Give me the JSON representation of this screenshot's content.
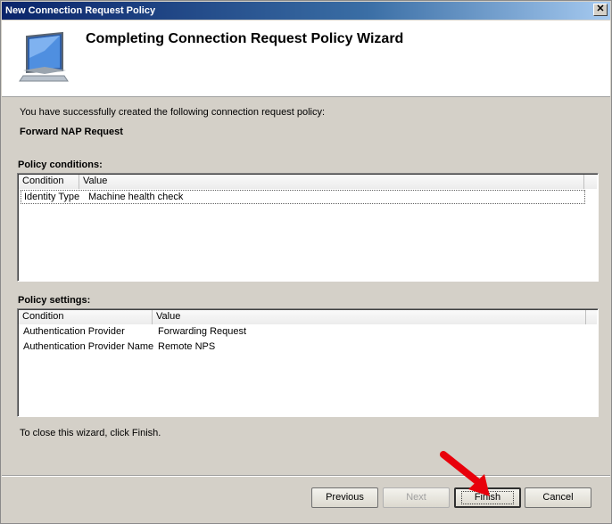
{
  "window": {
    "title": "New Connection Request Policy",
    "close_glyph": "✕"
  },
  "header": {
    "title": "Completing Connection Request Policy Wizard",
    "icon": "computer-monitor-icon"
  },
  "body": {
    "success_text": "You have successfully created the following connection request policy:",
    "policy_name": "Forward NAP Request",
    "close_hint": "To close this wizard, click Finish."
  },
  "conditions": {
    "label": "Policy conditions:",
    "columns": [
      "Condition",
      "Value"
    ],
    "rows": [
      {
        "condition": "Identity Type",
        "value": "Machine health check"
      }
    ]
  },
  "settings": {
    "label": "Policy settings:",
    "columns": [
      "Condition",
      "Value"
    ],
    "rows": [
      {
        "condition": "Authentication Provider",
        "value": "Forwarding Request"
      },
      {
        "condition": "Authentication Provider Name",
        "value": "Remote NPS"
      }
    ]
  },
  "buttons": {
    "previous": "Previous",
    "next": "Next",
    "finish": "Finish",
    "cancel": "Cancel"
  },
  "colors": {
    "annotation_arrow": "#e8000b"
  }
}
